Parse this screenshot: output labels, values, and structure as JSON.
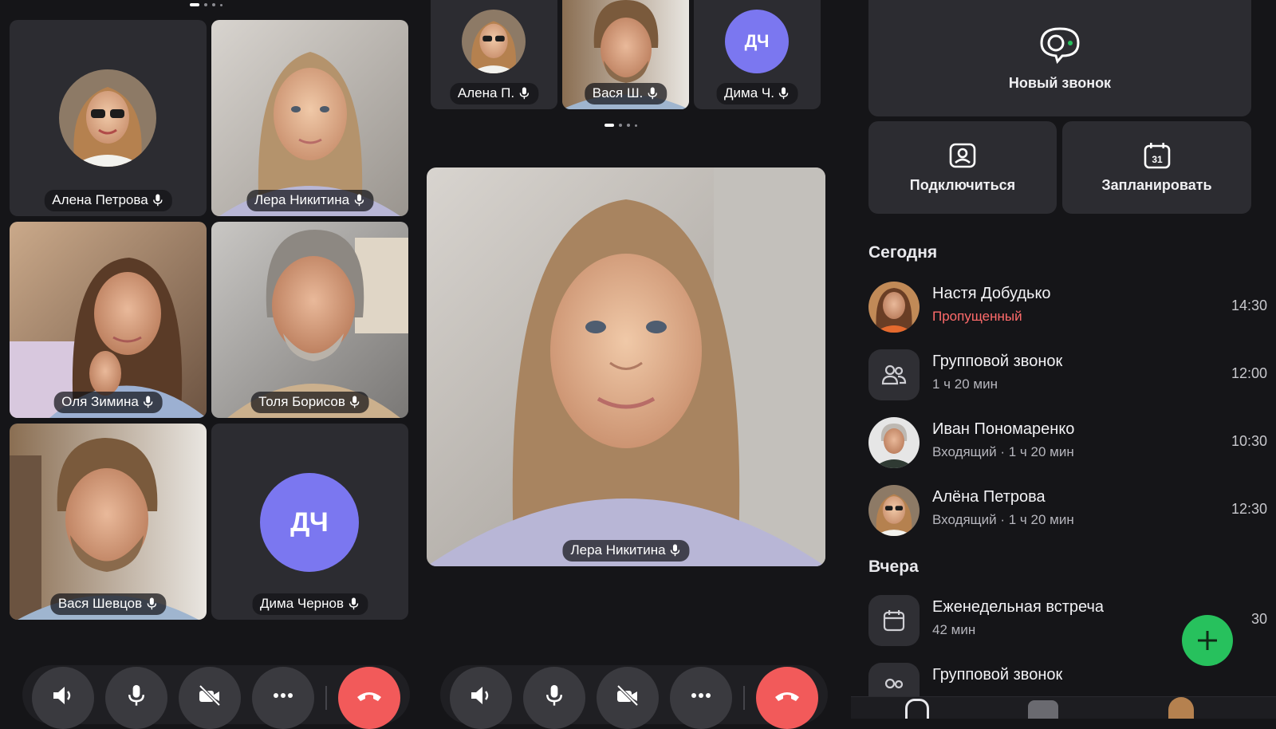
{
  "grid_call": {
    "participants": [
      {
        "name": "Алена Петрова",
        "initials": ""
      },
      {
        "name": "Лера Никитина",
        "initials": ""
      },
      {
        "name": "Оля Зимина",
        "initials": ""
      },
      {
        "name": "Толя Борисов",
        "initials": ""
      },
      {
        "name": "Вася Шевцов",
        "initials": ""
      },
      {
        "name": "Дима Чернов",
        "initials": "ДЧ"
      }
    ]
  },
  "speaker_call": {
    "strip": [
      {
        "name": "Алена П."
      },
      {
        "name": "Вася Ш."
      },
      {
        "name": "Дима Ч.",
        "initials": "ДЧ"
      }
    ],
    "main_speaker": "Лера Никитина"
  },
  "calls": {
    "new_call": "Новый звонок",
    "join": "Подключиться",
    "schedule": "Запланировать",
    "calendar_day": "31",
    "today_label": "Сегодня",
    "yesterday_label": "Вчера",
    "today": [
      {
        "name": "Настя Добудько",
        "sub": "Пропущенный",
        "time": "14:30",
        "missed": true
      },
      {
        "name": "Групповой звонок",
        "sub": "1 ч 20 мин",
        "time": "12:00"
      },
      {
        "name": "Иван Пономаренко",
        "sub": "Входящий · 1 ч 20 мин",
        "time": "10:30"
      },
      {
        "name": "Алёна Петрова",
        "sub": "Входящий · 1 ч 20 мин",
        "time": "12:30"
      }
    ],
    "yesterday": [
      {
        "name": "Еженедельная встреча",
        "sub": "42 мин",
        "time": "30"
      },
      {
        "name": "Групповой звонок"
      }
    ]
  },
  "colors": {
    "accent_avatar": "#7b77f0",
    "end_call": "#f25a5a",
    "fab": "#27c15d",
    "missed": "#ff6b6b"
  }
}
